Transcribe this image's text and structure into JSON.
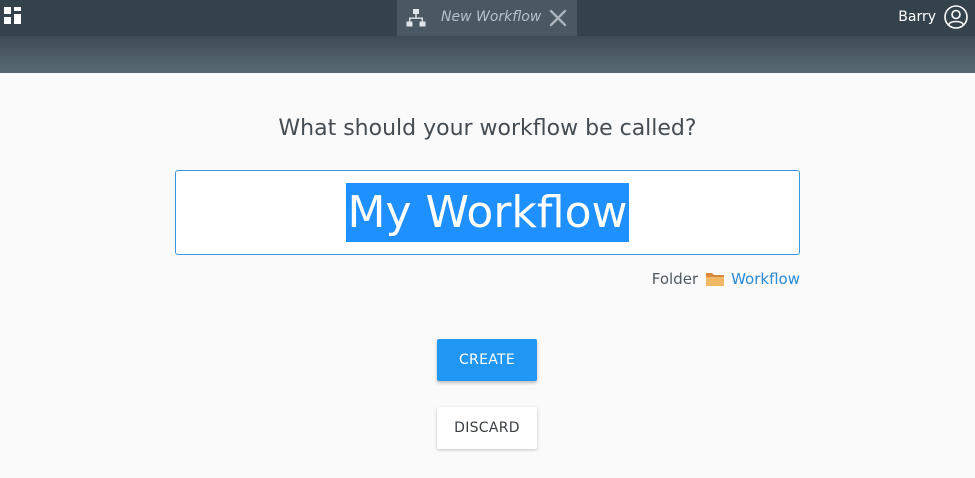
{
  "header": {
    "tab_title": "New Workflow",
    "user_name": "Barry",
    "icons": {
      "apps": "apps-grid-icon",
      "tab": "workflow-hierarchy-icon",
      "close": "close-icon",
      "user": "user-avatar-icon"
    }
  },
  "main": {
    "question": "What should your workflow be called?",
    "name_value": "My Workflow",
    "folder_label": "Folder",
    "folder_name": "Workflow",
    "folder_icon": "folder-icon",
    "create_label": "CREATE",
    "discard_label": "DISCARD"
  },
  "colors": {
    "accent": "#2196f3",
    "header": "#33424b",
    "selection": "#1e90ff",
    "link": "#2a8ad6"
  }
}
